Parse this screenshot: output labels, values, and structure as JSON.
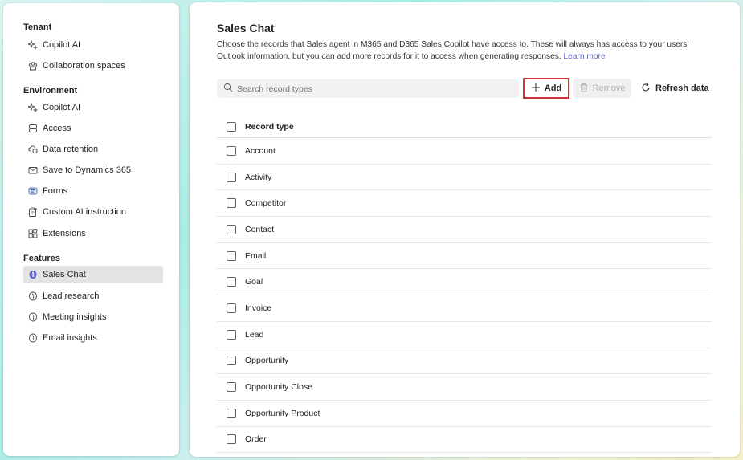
{
  "sidebar": {
    "sections": [
      {
        "title": "Tenant",
        "items": [
          {
            "label": "Copilot AI",
            "icon": "sparkle-icon"
          },
          {
            "label": "Collaboration spaces",
            "icon": "collaboration-icon"
          }
        ]
      },
      {
        "title": "Environment",
        "items": [
          {
            "label": "Copilot AI",
            "icon": "sparkle-icon"
          },
          {
            "label": "Access",
            "icon": "people-icon"
          },
          {
            "label": "Data retention",
            "icon": "cloud-retention-icon"
          },
          {
            "label": "Save to Dynamics 365",
            "icon": "mail-icon"
          },
          {
            "label": "Forms",
            "icon": "forms-icon"
          },
          {
            "label": "Custom AI instruction",
            "icon": "clipboard-sparkle-icon"
          },
          {
            "label": "Extensions",
            "icon": "extensions-icon"
          }
        ]
      },
      {
        "title": "Features",
        "items": [
          {
            "label": "Sales Chat",
            "icon": "copilot-icon",
            "active": true
          },
          {
            "label": "Lead research",
            "icon": "copilot-icon"
          },
          {
            "label": "Meeting insights",
            "icon": "copilot-icon"
          },
          {
            "label": "Email insights",
            "icon": "copilot-icon"
          }
        ]
      }
    ]
  },
  "main": {
    "title": "Sales Chat",
    "description": "Choose the records that Sales agent in M365 and D365 Sales Copilot have access to. These will always has access to your users' Outlook information, but you can add more records for it to access when generating responses.",
    "learn_more": "Learn more",
    "search_placeholder": "Search record types",
    "add_label": "Add",
    "remove_label": "Remove",
    "refresh_label": "Refresh data",
    "table": {
      "header": "Record type",
      "rows": [
        "Account",
        "Activity",
        "Competitor",
        "Contact",
        "Email",
        "Goal",
        "Invoice",
        "Lead",
        "Opportunity",
        "Opportunity Close",
        "Opportunity Product",
        "Order"
      ]
    }
  },
  "colors": {
    "accent": "#5b5fc7",
    "highlight_border": "#d13438",
    "active_nav_bg": "#e3e3e3"
  }
}
